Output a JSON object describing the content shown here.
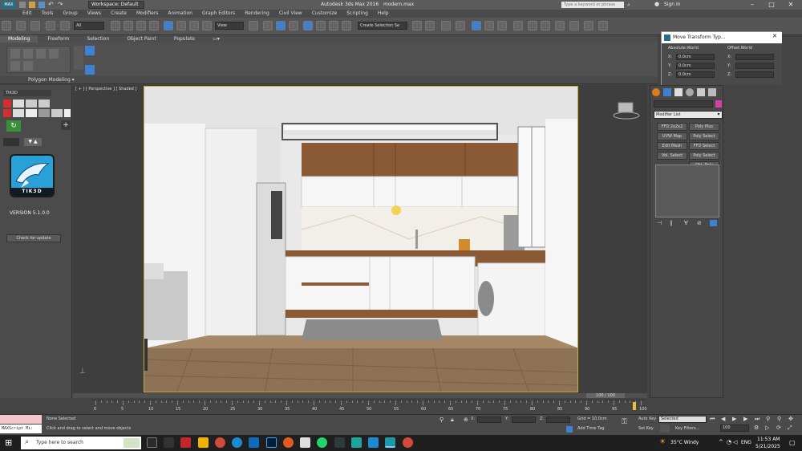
{
  "titlebar": {
    "app_title": "Autodesk 3ds Max 2016",
    "file_name": "modern.max",
    "workspace": "Workspace: Default",
    "search_placeholder": "Type a keyword or phrase",
    "sign_in": "Sign In"
  },
  "menu": [
    "Edit",
    "Tools",
    "Group",
    "Views",
    "Create",
    "Modifiers",
    "Animation",
    "Graph Editors",
    "Rendering",
    "Civil View",
    "Customize",
    "Scripting",
    "Help"
  ],
  "toolbar": {
    "selection_filter": "All",
    "ref_coord": "View",
    "named_selection": "Create Selection Se"
  },
  "ribbon": {
    "tabs": [
      "Modeling",
      "Freeform",
      "Selection",
      "Object Paint",
      "Populate"
    ],
    "active_tab": "Modeling",
    "panel_label": "Polygon Modeling ▾"
  },
  "left_panel": {
    "plugin_header": "TIK3D",
    "logo_text": "TIK3D",
    "version": "VERSION 5.1.0.0",
    "check_update": "Check for update"
  },
  "viewport": {
    "label": "[ + ] [ Perspective ] [ Shaded ]",
    "frame_counter": "100 / 100"
  },
  "move_transform": {
    "title": "Move Transform Typ...",
    "absolute_label": "Absolute:World",
    "offset_label": "Offset:World",
    "abs_x": "0.0cm",
    "abs_y": "0.0cm",
    "abs_z": "0.0cm",
    "x": "X:",
    "y": "Y:",
    "z": "Z:"
  },
  "command_panel": {
    "modifier_list": "Modifier List",
    "buttons": [
      "FFD 2x2x2",
      "Poly Plus",
      "UVW Map",
      "Poly Select",
      "Edit Mesh",
      "FFD Select",
      "Vol. Select",
      "Poly Select",
      "",
      "Dbl. Poly Select"
    ]
  },
  "timeline": {
    "ticks": [
      "0",
      "5",
      "10",
      "15",
      "20",
      "25",
      "30",
      "35",
      "40",
      "45",
      "50",
      "55",
      "60",
      "65",
      "70",
      "75",
      "80",
      "85",
      "90",
      "95",
      "100"
    ]
  },
  "status": {
    "maxscript": "MAXScript Mi:",
    "selection": "None Selected",
    "prompt": "Click and drag to select and move objects",
    "x_label": "X:",
    "y_label": "Y:",
    "z_label": "Z:",
    "grid": "Grid = 10.0cm",
    "add_time_tag": "Add Time Tag",
    "auto_key": "Auto Key",
    "set_key": "Set Key",
    "selected": "Selected",
    "key_filters": "Key Filters...",
    "frame": "100"
  },
  "taskbar": {
    "search_placeholder": "Type here to search",
    "weather": "35°C  Windy",
    "lang": "ENG",
    "time": "11:53 AM",
    "date": "5/21/2025"
  },
  "colors": {
    "accent": "#3f80d0",
    "wood": "#8a5a34",
    "cabinet_white": "#f1f1f1",
    "floor": "#8d7256"
  }
}
